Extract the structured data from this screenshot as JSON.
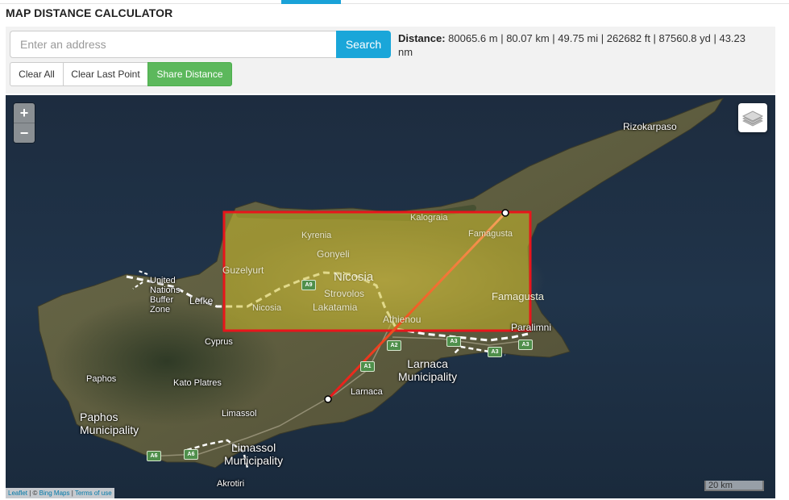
{
  "header": {
    "title": "MAP DISTANCE CALCULATOR"
  },
  "search": {
    "placeholder": "Enter an address",
    "value": "",
    "button_label": "Search"
  },
  "distance": {
    "label": "Distance:",
    "text": "80065.6 m | 80.07 km | 49.75 mi | 262682 ft | 87560.8 yd | 43.23 nm"
  },
  "actions": {
    "clear_all": "Clear All",
    "clear_last": "Clear Last Point",
    "share": "Share Distance"
  },
  "map": {
    "zoom_in": "+",
    "zoom_out": "−",
    "layers_icon": "layers-icon",
    "line_color": "#e8151b",
    "selection_color": "#e8151b",
    "labels": {
      "rizokarpaso": "Rizokarpaso",
      "kalograia": "Kalograia",
      "kyrenia": "Kyrenia",
      "famagusta_n": "Famagusta",
      "gonyeli": "Gonyeli",
      "guzelyurt": "Guzelyurt",
      "nicosia_big": "Nicosia",
      "strovolos": "Strovolos",
      "nicosia_small": "Nicosia",
      "lakatamia": "Lakatamia",
      "famagusta": "Famagusta",
      "athienou": "Athienou",
      "paralimni": "Paralimni",
      "un_buffer": "United\nNations\nBuffer\nZone",
      "lefke": "Lefke",
      "cyprus": "Cyprus",
      "larnaca_muni": "Larnaca\nMunicipality",
      "larnaca": "Larnaca",
      "paphos": "Paphos",
      "kato_platres": "Kato Platres",
      "paphos_muni": "Paphos\nMunicipality",
      "limassol": "Limassol",
      "limassol_muni": "Limassol\nMunicipality",
      "akrotiri": "Akrotiri"
    },
    "roads": {
      "a9": "A9",
      "a1": "A1",
      "a2": "A2",
      "a3a": "A3",
      "a3b": "A3",
      "a3c": "A3",
      "a6a": "A6",
      "a6b": "A6"
    },
    "attribution": {
      "leaflet": "Leaflet",
      "sep1": " | © ",
      "bing": "Bing Maps",
      "sep2": " | ",
      "terms": "Terms of use"
    },
    "scale": "20 km"
  }
}
